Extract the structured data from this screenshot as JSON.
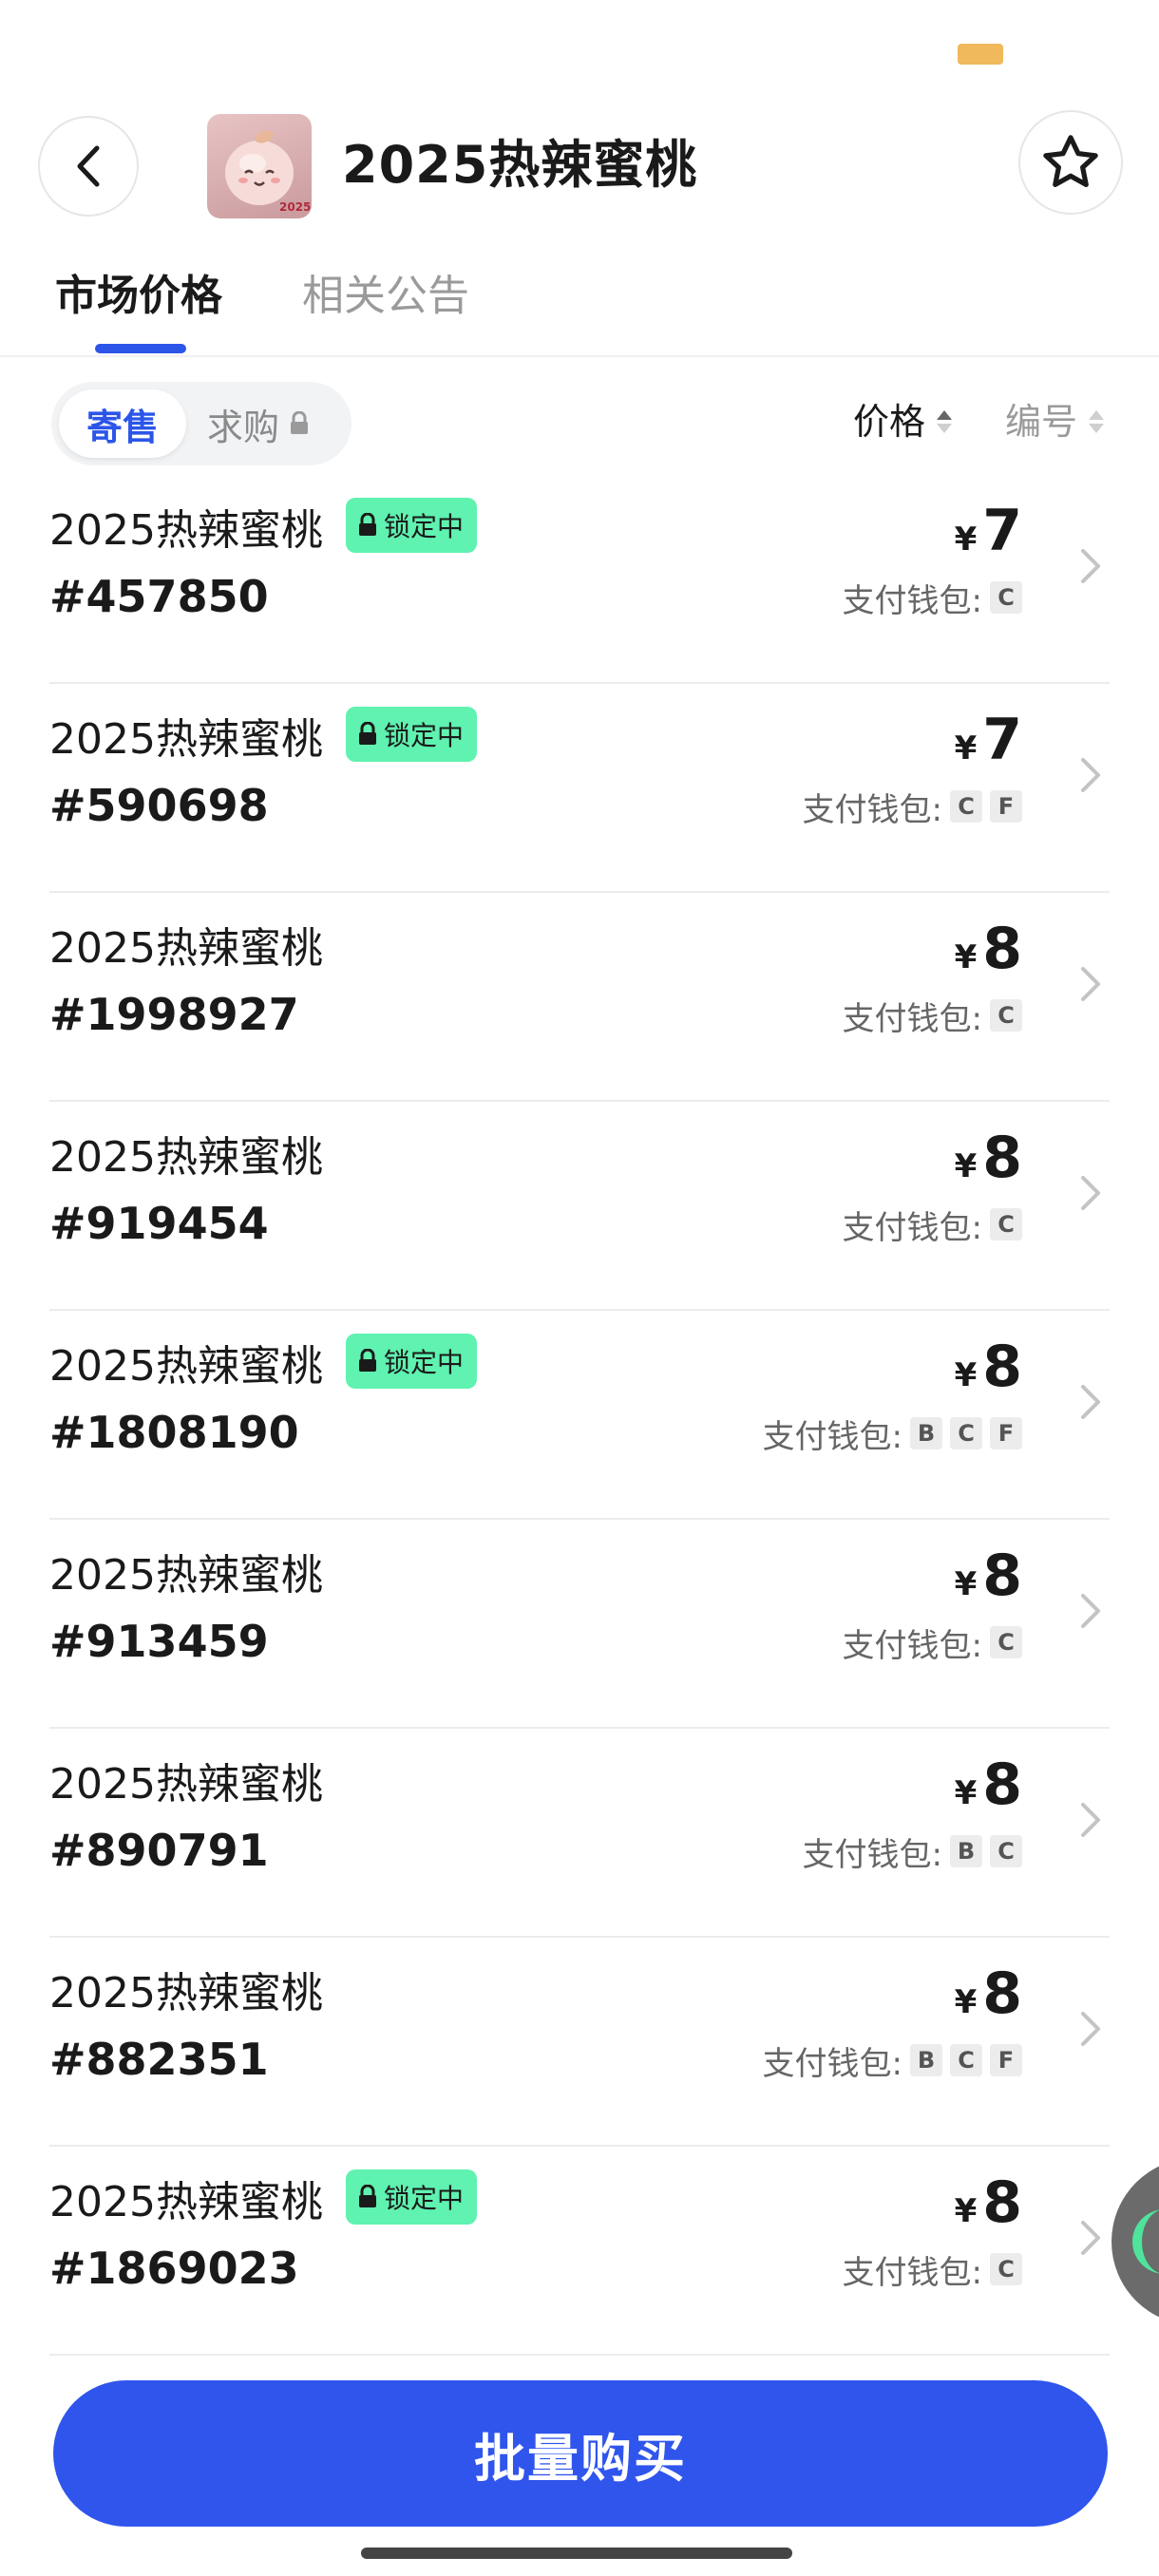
{
  "header": {
    "title": "2025热辣蜜桃",
    "thumbnail_label": "2025"
  },
  "tabs": [
    {
      "label": "市场价格",
      "active": true
    },
    {
      "label": "相关公告",
      "active": false
    }
  ],
  "filter": {
    "consign_label": "寄售",
    "buy_label": "求购",
    "sort_price_label": "价格",
    "sort_number_label": "编号"
  },
  "common": {
    "yen": "¥",
    "wallet_label": "支付钱包:",
    "lock_label": "锁定中"
  },
  "items": [
    {
      "name": "2025热辣蜜桃",
      "number": "#457850",
      "price": "7",
      "locked": true,
      "wallets": [
        "C"
      ]
    },
    {
      "name": "2025热辣蜜桃",
      "number": "#590698",
      "price": "7",
      "locked": true,
      "wallets": [
        "C",
        "F"
      ]
    },
    {
      "name": "2025热辣蜜桃",
      "number": "#1998927",
      "price": "8",
      "locked": false,
      "wallets": [
        "C"
      ]
    },
    {
      "name": "2025热辣蜜桃",
      "number": "#919454",
      "price": "8",
      "locked": false,
      "wallets": [
        "C"
      ]
    },
    {
      "name": "2025热辣蜜桃",
      "number": "#1808190",
      "price": "8",
      "locked": true,
      "wallets": [
        "B",
        "C",
        "F"
      ]
    },
    {
      "name": "2025热辣蜜桃",
      "number": "#913459",
      "price": "8",
      "locked": false,
      "wallets": [
        "C"
      ]
    },
    {
      "name": "2025热辣蜜桃",
      "number": "#890791",
      "price": "8",
      "locked": false,
      "wallets": [
        "B",
        "C"
      ]
    },
    {
      "name": "2025热辣蜜桃",
      "number": "#882351",
      "price": "8",
      "locked": false,
      "wallets": [
        "B",
        "C",
        "F"
      ]
    },
    {
      "name": "2025热辣蜜桃",
      "number": "#1869023",
      "price": "8",
      "locked": true,
      "wallets": [
        "C"
      ]
    }
  ],
  "bulk_buy_label": "批量购买",
  "colors": {
    "accent": "#2c55e8",
    "lock_badge": "#5ff2b0",
    "primary_button": "#2f55ec"
  }
}
